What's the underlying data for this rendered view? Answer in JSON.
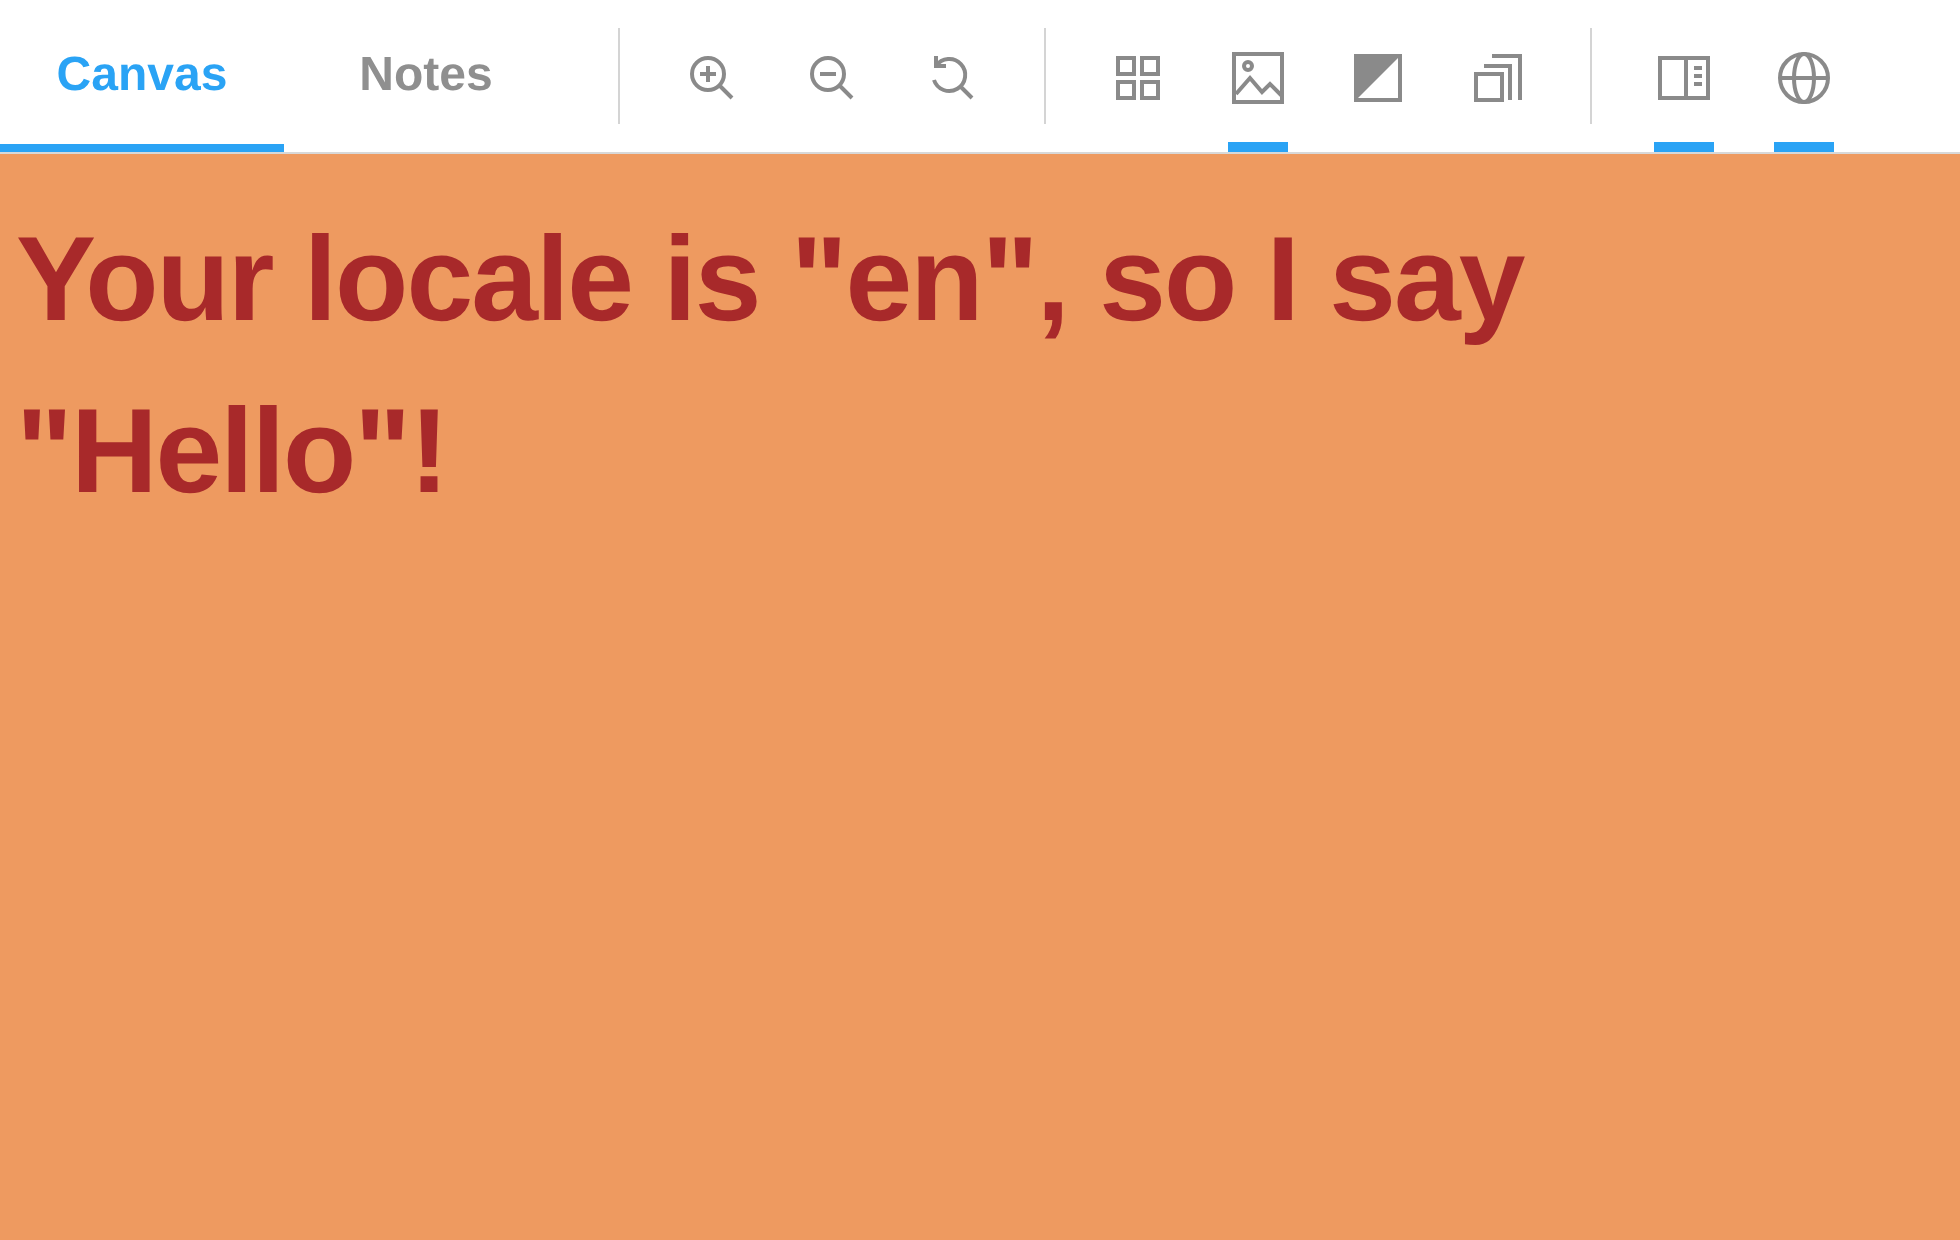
{
  "tabs": [
    {
      "label": "Canvas",
      "selected": true
    },
    {
      "label": "Notes",
      "selected": false
    }
  ],
  "tool_groups": [
    [
      {
        "kind": "zoom-in",
        "selected": false
      },
      {
        "kind": "zoom-out",
        "selected": false
      },
      {
        "kind": "reset",
        "selected": false
      }
    ],
    [
      {
        "kind": "grid",
        "selected": false
      },
      {
        "kind": "image",
        "selected": true
      },
      {
        "kind": "contrast",
        "selected": false
      },
      {
        "kind": "layers",
        "selected": false
      }
    ],
    [
      {
        "kind": "panel",
        "selected": true
      },
      {
        "kind": "globe",
        "selected": true
      }
    ]
  ],
  "canvas": {
    "message": "Your locale is \"en\", so I say \"Hello\"!"
  }
}
